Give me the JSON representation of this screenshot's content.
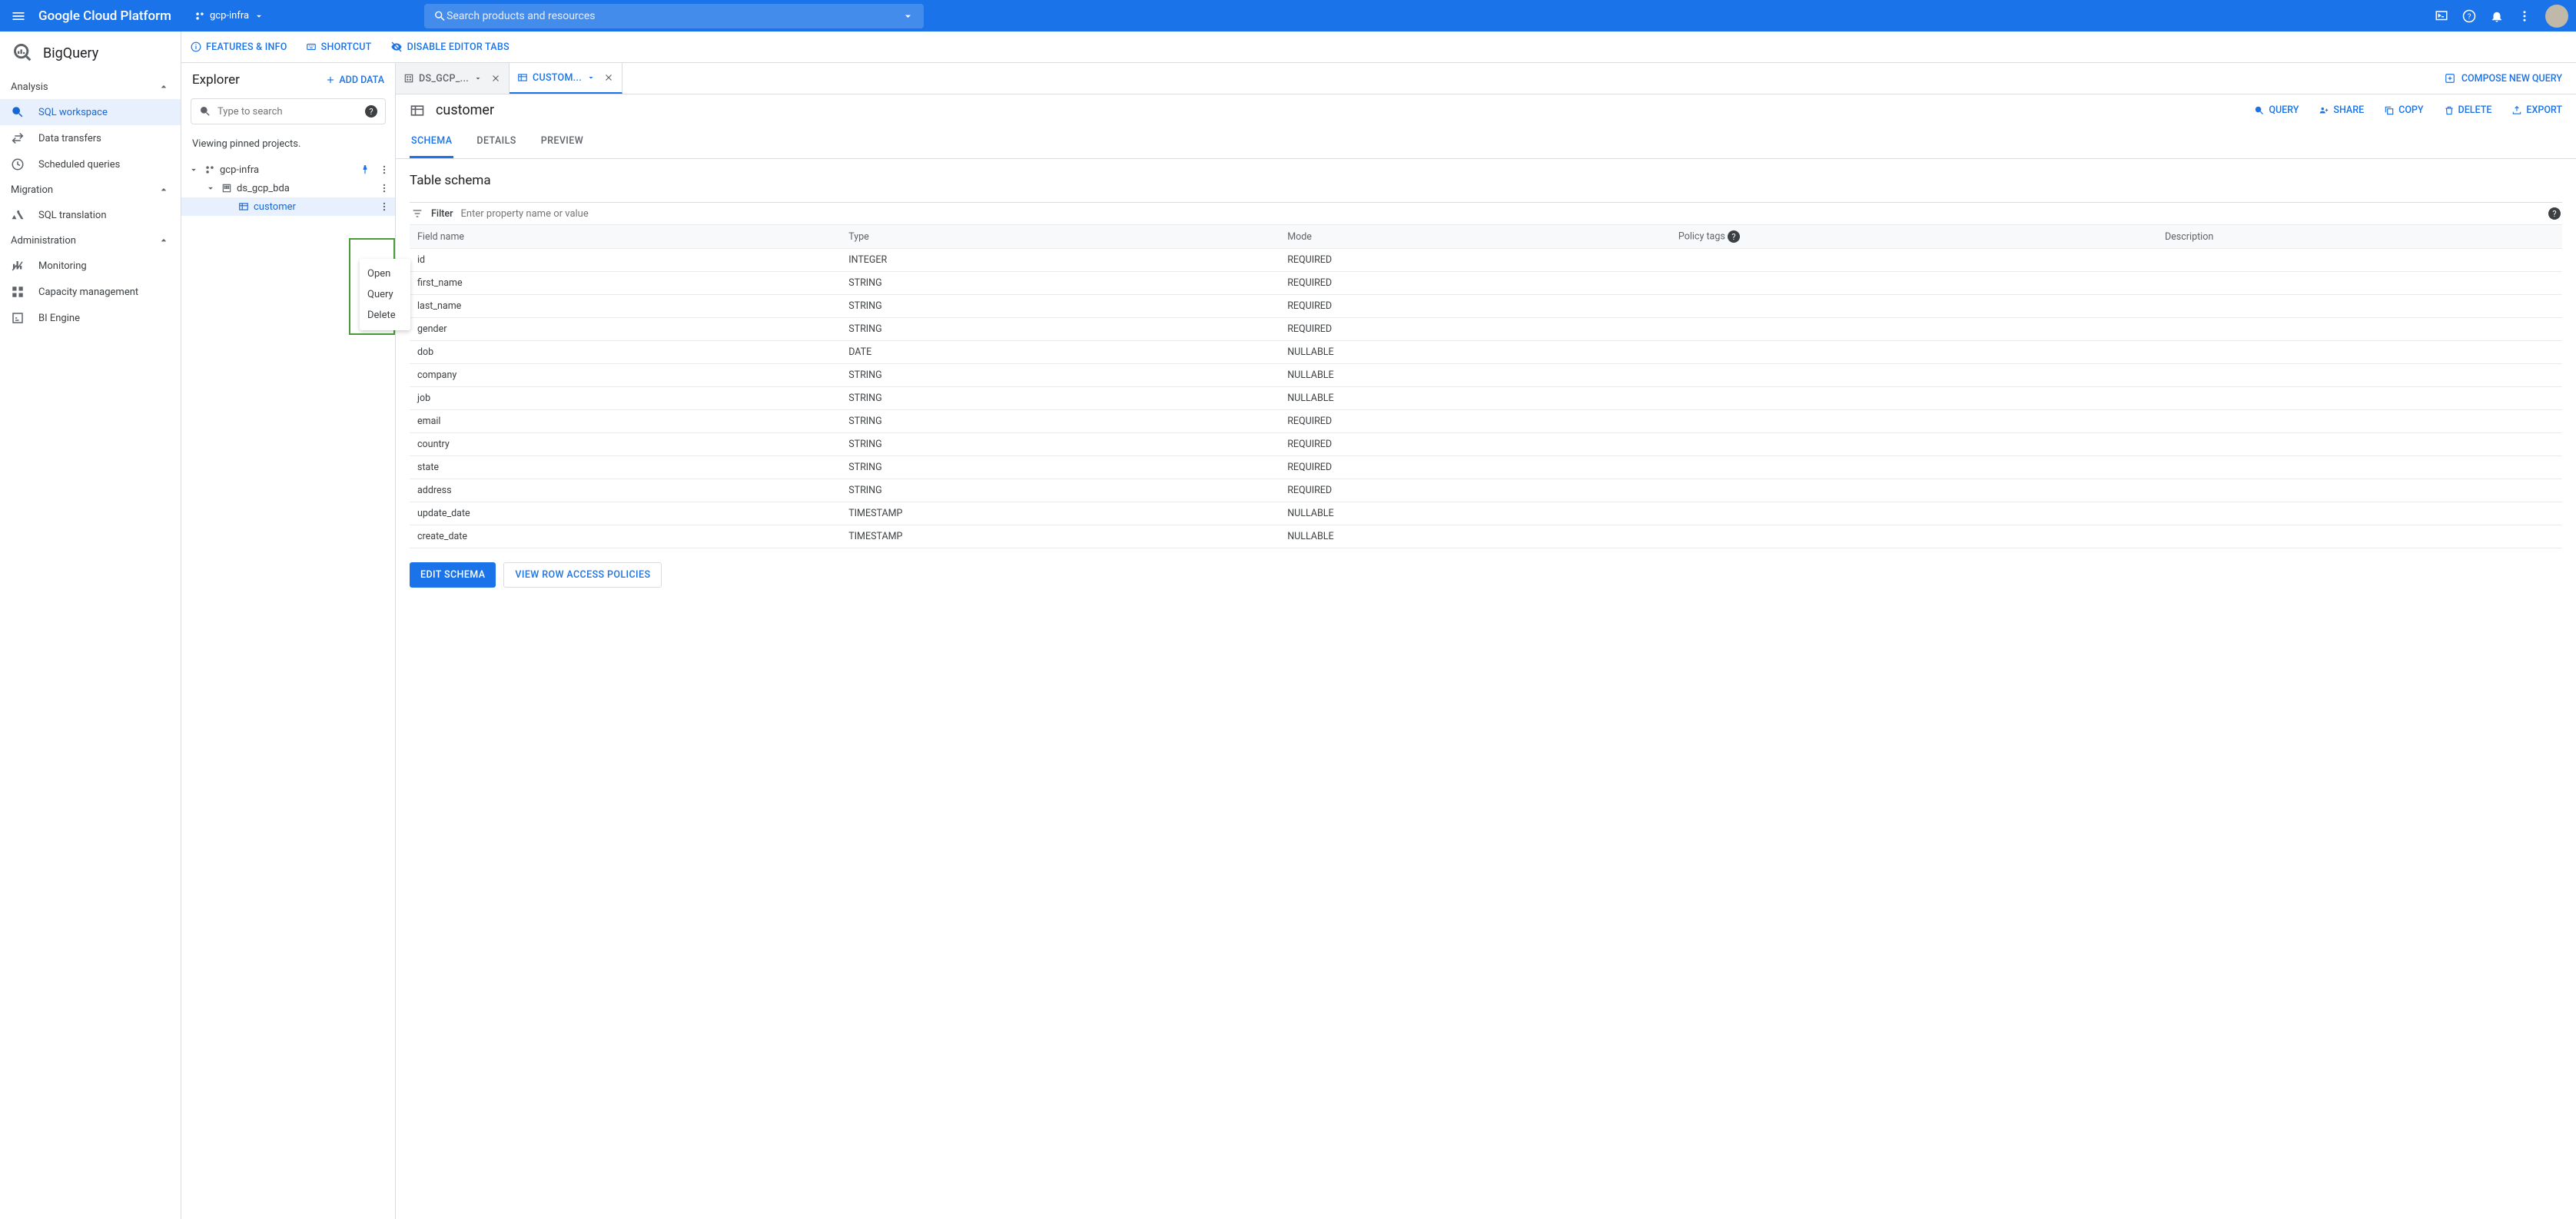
{
  "header": {
    "logo": "Google Cloud Platform",
    "project": "gcp-infra",
    "search_placeholder": "Search products and resources"
  },
  "product_title": "BigQuery",
  "sidebar": {
    "sections": [
      {
        "label": "Analysis",
        "items": [
          {
            "label": "SQL workspace",
            "active": true
          },
          {
            "label": "Data transfers",
            "active": false
          },
          {
            "label": "Scheduled queries",
            "active": false
          }
        ]
      },
      {
        "label": "Migration",
        "items": [
          {
            "label": "SQL translation",
            "active": false
          }
        ]
      },
      {
        "label": "Administration",
        "items": [
          {
            "label": "Monitoring",
            "active": false
          },
          {
            "label": "Capacity management",
            "active": false
          },
          {
            "label": "BI Engine",
            "active": false
          }
        ]
      }
    ]
  },
  "explorer": {
    "top_links": {
      "features": "FEATURES & INFO",
      "shortcut": "SHORTCUT",
      "disable": "DISABLE EDITOR TABS"
    },
    "title": "Explorer",
    "add_data": "ADD DATA",
    "search_placeholder": "Type to search",
    "pinned_note": "Viewing pinned projects.",
    "tree": {
      "project": "gcp-infra",
      "dataset": "ds_gcp_bda",
      "table": "customer"
    },
    "context_menu": {
      "open": "Open",
      "query": "Query",
      "delete": "Delete"
    }
  },
  "tabs": [
    {
      "label": "DS_GCP_...",
      "active": false
    },
    {
      "label": "CUSTOM...",
      "active": true
    }
  ],
  "compose_label": "COMPOSE NEW QUERY",
  "table_view": {
    "name": "customer",
    "actions": {
      "query": "QUERY",
      "share": "SHARE",
      "copy": "COPY",
      "delete": "DELETE",
      "export": "EXPORT"
    },
    "subtabs": {
      "schema": "SCHEMA",
      "details": "DETAILS",
      "preview": "PREVIEW"
    },
    "section_title": "Table schema",
    "filter_label": "Filter",
    "filter_placeholder": "Enter property name or value",
    "columns": {
      "field": "Field name",
      "type": "Type",
      "mode": "Mode",
      "policy": "Policy tags",
      "desc": "Description"
    },
    "rows": [
      {
        "field": "id",
        "type": "INTEGER",
        "mode": "REQUIRED"
      },
      {
        "field": "first_name",
        "type": "STRING",
        "mode": "REQUIRED"
      },
      {
        "field": "last_name",
        "type": "STRING",
        "mode": "REQUIRED"
      },
      {
        "field": "gender",
        "type": "STRING",
        "mode": "REQUIRED"
      },
      {
        "field": "dob",
        "type": "DATE",
        "mode": "NULLABLE"
      },
      {
        "field": "company",
        "type": "STRING",
        "mode": "NULLABLE"
      },
      {
        "field": "job",
        "type": "STRING",
        "mode": "NULLABLE"
      },
      {
        "field": "email",
        "type": "STRING",
        "mode": "REQUIRED"
      },
      {
        "field": "country",
        "type": "STRING",
        "mode": "REQUIRED"
      },
      {
        "field": "state",
        "type": "STRING",
        "mode": "REQUIRED"
      },
      {
        "field": "address",
        "type": "STRING",
        "mode": "REQUIRED"
      },
      {
        "field": "update_date",
        "type": "TIMESTAMP",
        "mode": "NULLABLE"
      },
      {
        "field": "create_date",
        "type": "TIMESTAMP",
        "mode": "NULLABLE"
      }
    ],
    "buttons": {
      "edit": "EDIT SCHEMA",
      "row_access": "VIEW ROW ACCESS POLICIES"
    }
  }
}
